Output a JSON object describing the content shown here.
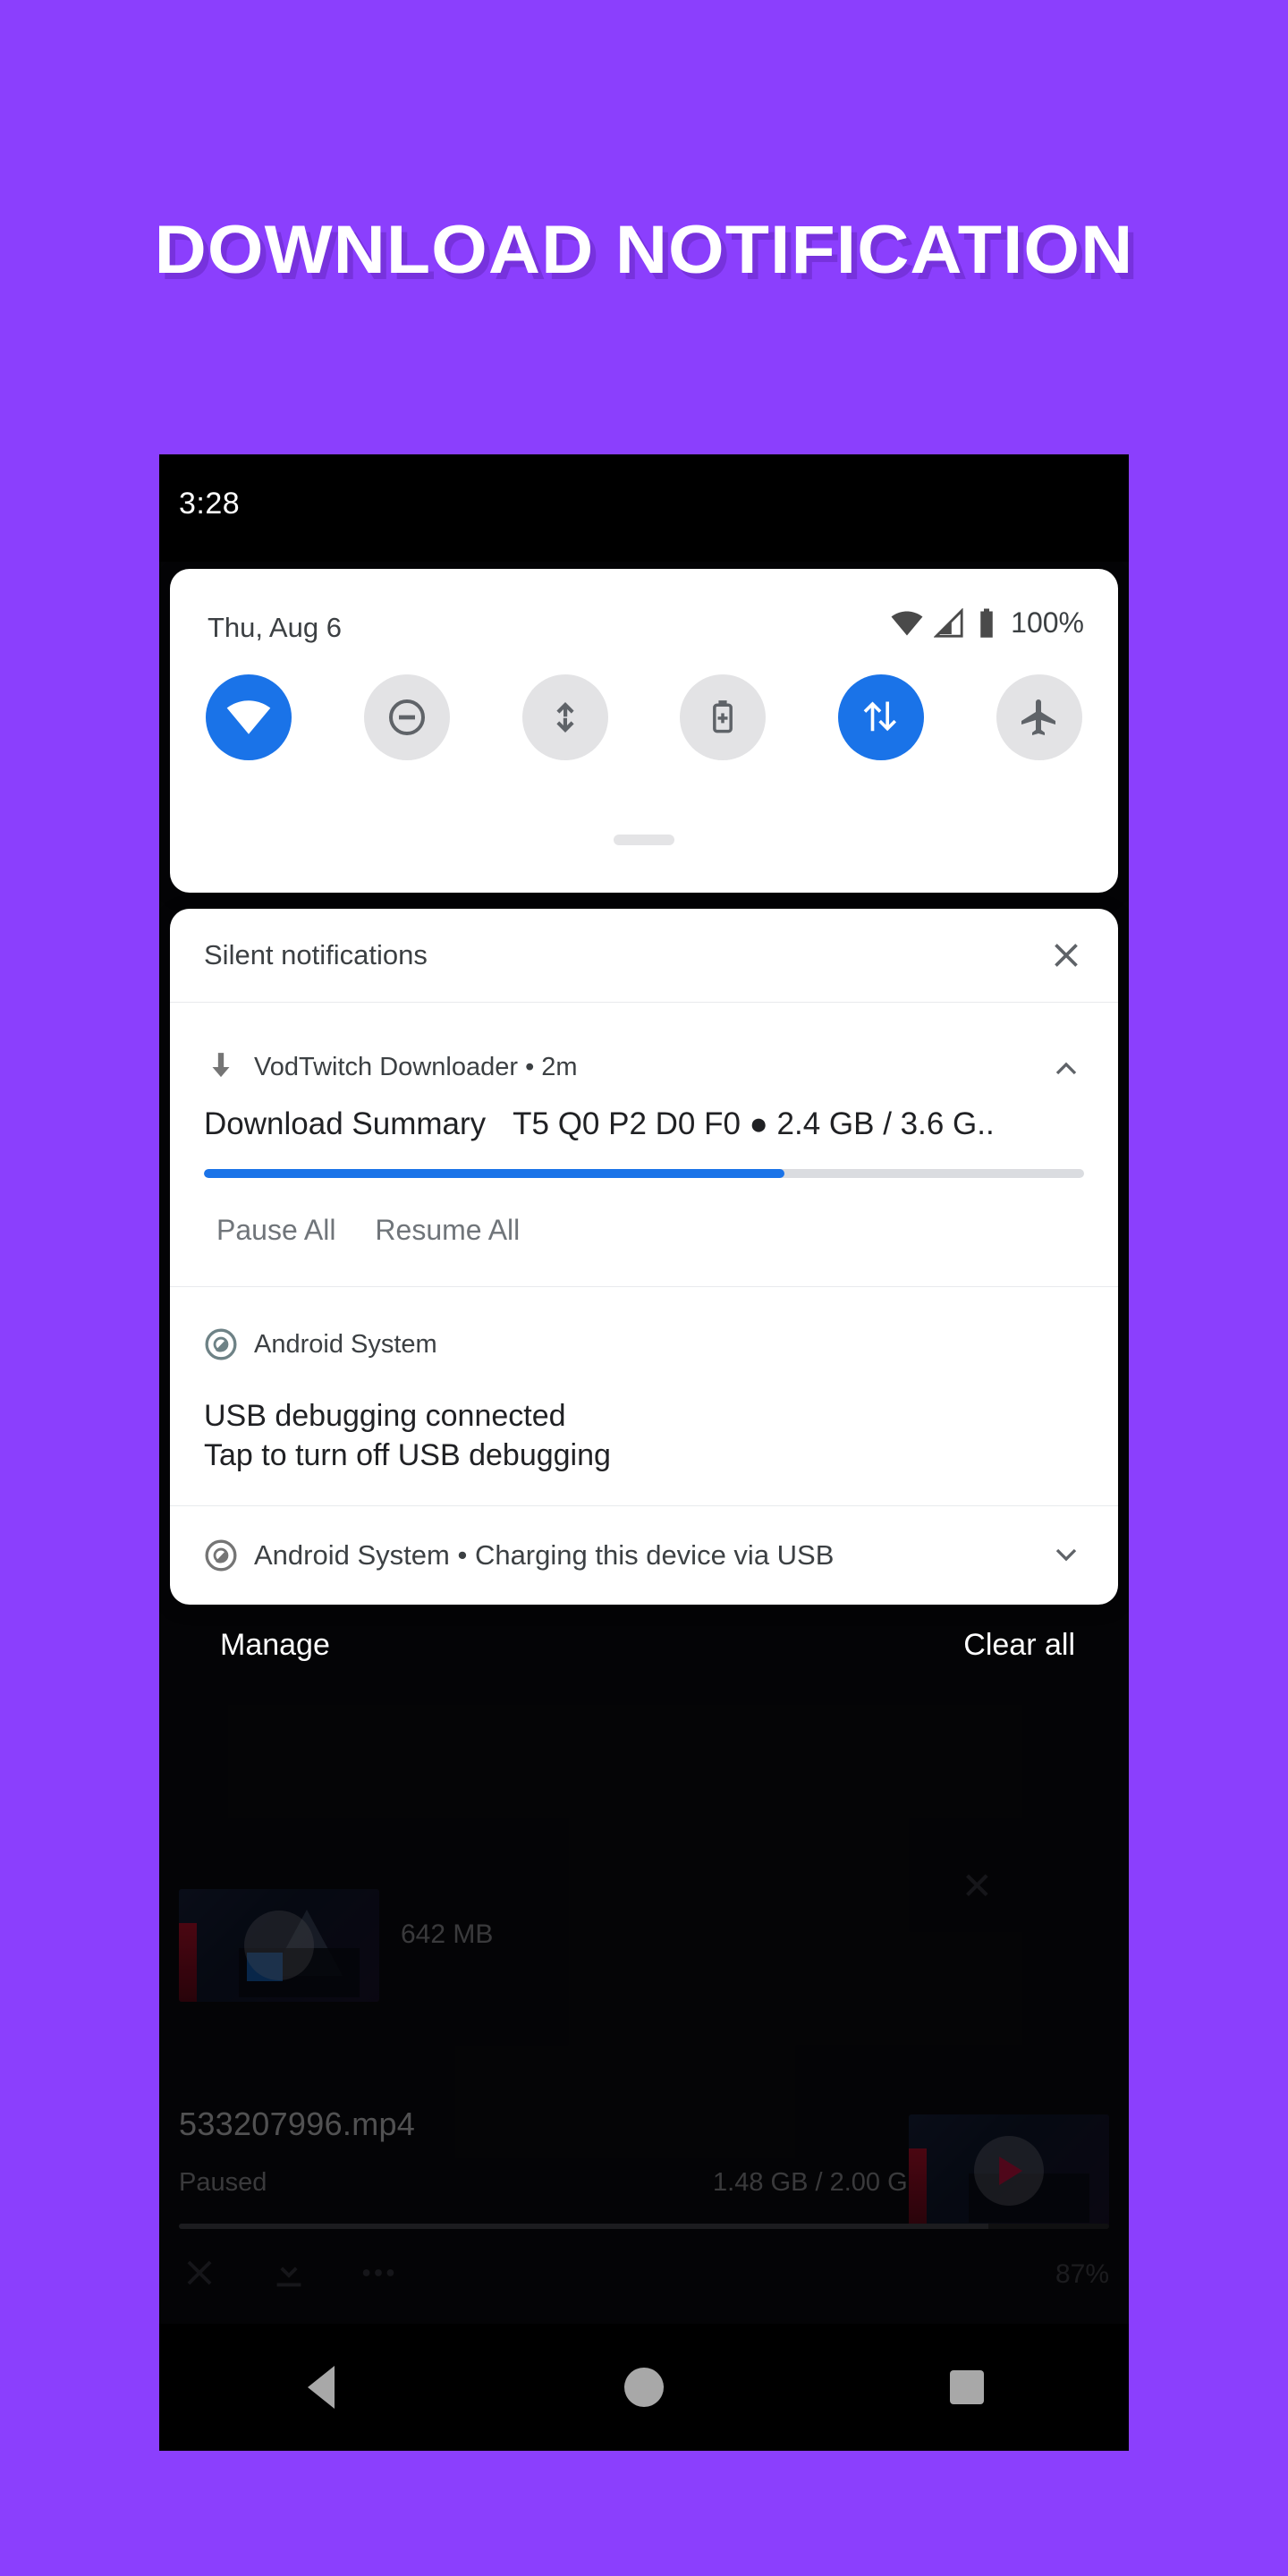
{
  "promo": {
    "title": "DOWNLOAD NOTIFICATION",
    "background_color": "#8b3ffd",
    "title_color": "#ffffff"
  },
  "status_bar": {
    "clock": "3:28"
  },
  "quick_settings": {
    "date": "Thu, Aug 6",
    "battery_percent": "100%",
    "status_icons": [
      "wifi-icon",
      "cell-signal-icon",
      "battery-icon"
    ],
    "tiles": [
      {
        "name": "wifi",
        "icon": "wifi-icon",
        "active": true
      },
      {
        "name": "do-not-disturb",
        "icon": "do-not-disturb-icon",
        "active": false
      },
      {
        "name": "auto-rotate",
        "icon": "auto-rotate-icon",
        "active": false
      },
      {
        "name": "battery-saver",
        "icon": "battery-saver-icon",
        "active": false
      },
      {
        "name": "mobile-data",
        "icon": "mobile-data-icon",
        "active": true
      },
      {
        "name": "airplane-mode",
        "icon": "airplane-icon",
        "active": false
      }
    ],
    "accent_color": "#1a73e8",
    "tile_off_color": "#e3e3e5"
  },
  "shade": {
    "section_title": "Silent notifications",
    "close_icon": "close-icon"
  },
  "download_notification": {
    "app_icon": "download-arrow-icon",
    "app_name": "VodTwitch Downloader",
    "time": "2m",
    "separator": "•",
    "expand_icon": "chevron-up-icon",
    "title": "Download Summary",
    "detail": "T5 Q0 P2 D0 F0 ● 2.4 GB / 3.6 G..",
    "progress_percent": 66,
    "progress_color": "#1a73e8",
    "actions": [
      {
        "label": "Pause All"
      },
      {
        "label": "Resume All"
      }
    ]
  },
  "usb_debug_notification": {
    "app_icon": "android-system-icon",
    "app_name": "Android System",
    "line1": "USB debugging connected",
    "line2": "Tap to turn off USB debugging"
  },
  "charging_notification": {
    "app_icon": "android-system-icon",
    "app_name": "Android System",
    "separator": "•",
    "text": "Charging this device via USB",
    "expand_icon": "chevron-down-icon"
  },
  "shade_footer": {
    "manage_label": "Manage",
    "clear_all_label": "Clear all"
  },
  "background_app": {
    "rows": [
      {
        "size_label": "642 MB",
        "close_icon": "close-icon"
      },
      {
        "filename": "533207996.mp4",
        "state": "Paused",
        "size": "1.48 GB / 2.00 GB",
        "percent": "87%",
        "progress_percent": 87,
        "actions": [
          "close-icon",
          "download-icon",
          "more-icon"
        ]
      }
    ]
  },
  "nav_bar": {
    "buttons": [
      {
        "name": "back",
        "icon": "back-triangle-icon"
      },
      {
        "name": "home",
        "icon": "home-circle-icon"
      },
      {
        "name": "recents",
        "icon": "recents-square-icon"
      }
    ]
  }
}
